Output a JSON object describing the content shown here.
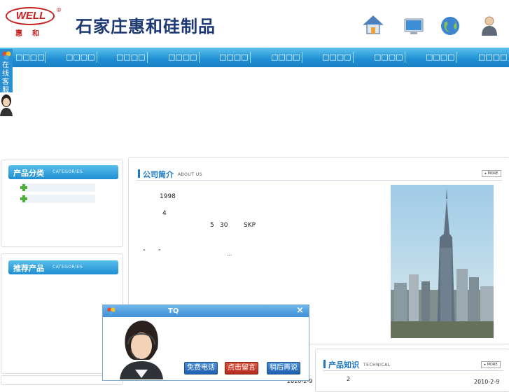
{
  "brand": {
    "logo_word": "WELL",
    "logo_sub": "惠和",
    "registered": "®",
    "company_name": "石家庄惠和硅制品"
  },
  "header_icons": [
    "home-icon",
    "computer-icon",
    "globe-icon",
    "user-icon"
  ],
  "nav": {
    "items": [
      "□□□□",
      "□□□□",
      "□□□□",
      "□□□□",
      "□□□□",
      "□□□□",
      "□□□□",
      "□□□□",
      "□□□□",
      "□□□□"
    ]
  },
  "side_service": {
    "label": "在线客服"
  },
  "categories_panel": {
    "title": "产品分类",
    "title_en": "CATEGORIES",
    "items": [
      "",
      ""
    ]
  },
  "recommended_panel": {
    "title": "推荐产品",
    "title_en": "CATEGORIES"
  },
  "about": {
    "title": "公司简介",
    "title_en": "ABOUT US",
    "more": "MORE",
    "text_fragments": [
      "1998",
      "4",
      "5",
      "30",
      "SKP",
      "“",
      "”",
      "…"
    ]
  },
  "knowledge": {
    "title": "产品知识",
    "title_en": "TECHNICAL",
    "more": "MORE",
    "row_date_left": "2010-2-9",
    "row_date_right": "2010-2-9",
    "row_num": "2"
  },
  "tq": {
    "title": "TQ",
    "close": "×",
    "buttons": [
      "免费电话",
      "点击留言",
      "稍后再说"
    ]
  },
  "colors": {
    "nav_blue": "#1f8fd3",
    "accent_blue": "#1c78c4",
    "brand_red": "#c81d1d",
    "leave_msg_red": "#c93b2d"
  }
}
